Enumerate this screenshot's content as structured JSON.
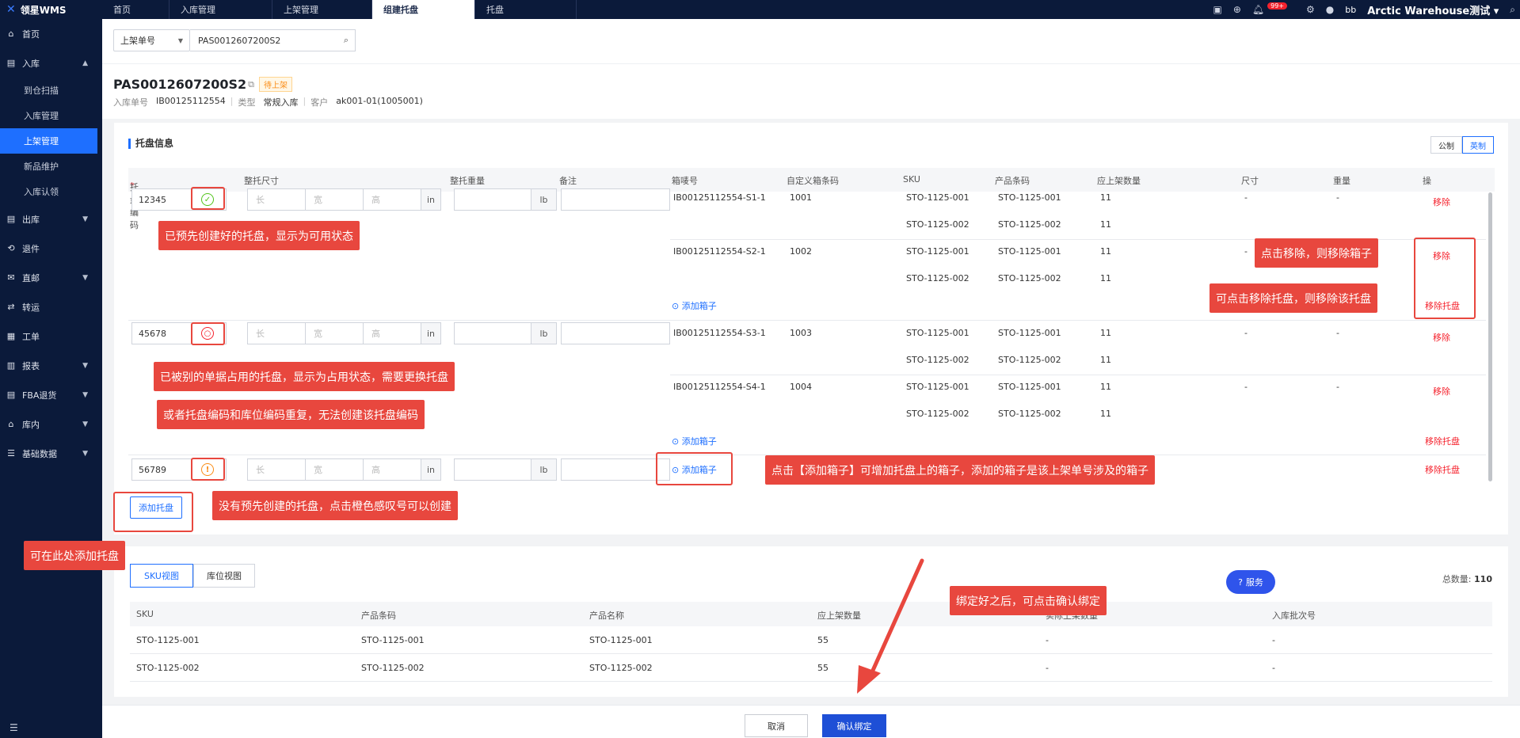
{
  "app": {
    "logo_text": "领星WMS"
  },
  "nav_tabs": [
    {
      "label": "首页"
    },
    {
      "label": "入库管理"
    },
    {
      "label": "上架管理"
    },
    {
      "label": "组建托盘"
    },
    {
      "label": "托盘"
    }
  ],
  "topbar": {
    "notif_count": "99+",
    "user": "bb",
    "warehouse": "Arctic Warehouse测试"
  },
  "sidebar": {
    "items": [
      {
        "label": "首页",
        "icon": "home-icon"
      },
      {
        "label": "入库",
        "icon": "inbound-icon"
      },
      {
        "label": "出库",
        "icon": "outbound-icon"
      },
      {
        "label": "退件",
        "icon": "return-icon"
      },
      {
        "label": "直邮",
        "icon": "mail-icon"
      },
      {
        "label": "转运",
        "icon": "transfer-icon"
      },
      {
        "label": "工单",
        "icon": "ticket-icon"
      },
      {
        "label": "报表",
        "icon": "report-icon"
      },
      {
        "label": "FBA退货",
        "icon": "fba-icon"
      },
      {
        "label": "库内",
        "icon": "warehouse-icon"
      },
      {
        "label": "基础数据",
        "icon": "database-icon"
      }
    ],
    "sub_items": [
      {
        "label": "到仓扫描"
      },
      {
        "label": "入库管理"
      },
      {
        "label": "上架管理"
      },
      {
        "label": "新品维护"
      },
      {
        "label": "入库认领"
      }
    ]
  },
  "search": {
    "field": "上架单号",
    "value": "PAS0012607200S2"
  },
  "header": {
    "title": "PAS0012607200S2",
    "status": "待上架",
    "inbound_label": "入库单号",
    "inbound_value": "IB00125112554",
    "type_label": "类型",
    "type_value": "常规入库",
    "customer_label": "客户",
    "customer_value": "ak001-01(1005001)"
  },
  "pallet_section": {
    "title": "托盘信息",
    "unit_metric": "公制",
    "unit_imperial": "英制",
    "columns": [
      "托盘编码",
      "整托尺寸",
      "整托重量",
      "备注",
      "箱唛号",
      "自定义箱条码",
      "SKU",
      "产品条码",
      "应上架数量",
      "尺寸",
      "重量",
      "操"
    ],
    "dim_placeholders": {
      "l": "长",
      "w": "宽",
      "h": "高",
      "len_unit": "in",
      "wt_unit": "lb"
    },
    "pallets": [
      {
        "code": "12345"
      },
      {
        "code": "45678"
      },
      {
        "code": "56789"
      }
    ],
    "boxes": [
      {
        "box": "IB00125112554-S1-1",
        "custom": "1001",
        "size": "-",
        "weight": "-",
        "lines": [
          [
            "STO-1125-001",
            "STO-1125-001",
            "11"
          ],
          [
            "STO-1125-002",
            "STO-1125-002",
            "11"
          ]
        ]
      },
      {
        "box": "IB00125112554-S2-1",
        "custom": "1002",
        "size": "-",
        "weight": "",
        "lines": [
          [
            "STO-1125-001",
            "STO-1125-001",
            "11"
          ],
          [
            "STO-1125-002",
            "STO-1125-002",
            "11"
          ]
        ]
      },
      {
        "box": "IB00125112554-S3-1",
        "custom": "1003",
        "size": "-",
        "weight": "-",
        "lines": [
          [
            "STO-1125-001",
            "STO-1125-001",
            "11"
          ],
          [
            "STO-1125-002",
            "STO-1125-002",
            "11"
          ]
        ]
      },
      {
        "box": "IB00125112554-S4-1",
        "custom": "1004",
        "size": "-",
        "weight": "-",
        "lines": [
          [
            "STO-1125-001",
            "STO-1125-001",
            "11"
          ],
          [
            "STO-1125-002",
            "STO-1125-002",
            "11"
          ]
        ]
      }
    ],
    "remove": "移除",
    "remove_pallet": "移除托盘",
    "add_box": "添加箱子",
    "add_pallet": "添加托盘"
  },
  "annotations": {
    "a1": "已预先创建好的托盘，显示为可用状态",
    "a2": "已被别的单据占用的托盘，显示为占用状态，需要更换托盘",
    "a3": "或者托盘编码和库位编码重复，无法创建该托盘编码",
    "a4": "没有预先创建的托盘，点击橙色感叹号可以创建",
    "a5": "可在此处添加托盘",
    "a6": "点击移除，则移除箱子",
    "a7": "可点击移除托盘，则移除该托盘",
    "a8": "点击【添加箱子】可增加托盘上的箱子，添加的箱子是该上架单号涉及的箱子",
    "a9": "绑定好之后，可点击确认绑定"
  },
  "summary": {
    "tab_sku": "SKU视图",
    "tab_loc": "库位视图",
    "total_label": "总数量:",
    "total_value": "110",
    "help": "服务",
    "columns": [
      "SKU",
      "产品条码",
      "产品名称",
      "应上架数量",
      "实际上架数量",
      "入库批次号"
    ],
    "rows": [
      [
        "STO-1125-001",
        "STO-1125-001",
        "STO-1125-001",
        "55",
        "-",
        "-"
      ],
      [
        "STO-1125-002",
        "STO-1125-002",
        "STO-1125-002",
        "55",
        "-",
        "-"
      ]
    ]
  },
  "footer": {
    "cancel": "取消",
    "confirm": "确认绑定"
  },
  "colors": {
    "primary": "#1e6fff",
    "sidebar": "#0b1a3a",
    "danger": "#f5222d",
    "callout": "#e8473e"
  }
}
